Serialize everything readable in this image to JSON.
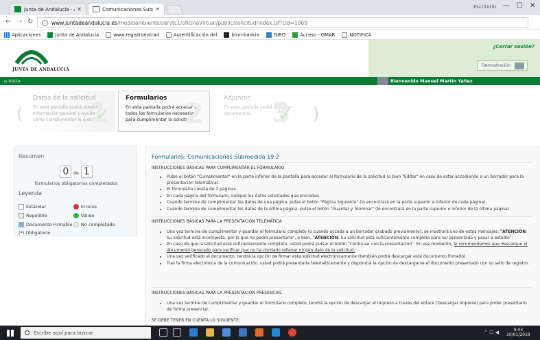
{
  "browser": {
    "tabs": [
      {
        "label": "Junta de Andalucía - Ayu",
        "icon": "junta-favicon"
      },
      {
        "label": "Comunicaciones Submer",
        "icon": "document-favicon"
      }
    ],
    "window_label": "Escritorio",
    "url_domain": "www.juntadeandalucia.es",
    "url_path": "/medioambiente/servtc1/oficinaVirtual/public/solicitud/index.jsf?cid=1969",
    "bookmarks": [
      {
        "label": "Aplicaciones",
        "icon": "apps-icon"
      },
      {
        "label": "Junta de Andalucía",
        "icon": "junta-icon"
      },
      {
        "label": "www.registroentrad",
        "icon": "page-icon"
      },
      {
        "label": "Autentificación del",
        "icon": "mail-icon"
      },
      {
        "label": "bmn-bankia",
        "icon": "bmn-icon"
      },
      {
        "label": "GIRO",
        "icon": "giro-icon"
      },
      {
        "label": "Acceso - GMAR",
        "icon": "gmar-icon"
      },
      {
        "label": "NOTIFICA",
        "icon": "page-icon"
      }
    ]
  },
  "site": {
    "brand": "JUNTA DE ANDALUCIA",
    "logout": "¿Cerrar sesión?",
    "demo_label": "Demostración",
    "home": "Inicio",
    "user_name": "Bienvenido Manuel Martín Yañez",
    "brand_color": "#0a7a33"
  },
  "steps": [
    {
      "number": "1",
      "title": "Datos de la solicitud",
      "desc": "En esta pantalla podrá obtener información general y ayuda de cómo cumplimentar la solicitud."
    },
    {
      "number": "2",
      "title": "Formularios",
      "desc": "En esta pantalla podrá acceder a todos los formularios necesarios para cumplimentar la solicitud."
    },
    {
      "number": "3",
      "title": "Adjuntos",
      "desc": "En esta pantalla podrá adjuntar documentos."
    }
  ],
  "summary": {
    "title": "Resumen",
    "completed": "0",
    "of": "de",
    "total": "1",
    "note": "formularios obligatorios completados",
    "legend_title": "Leyenda",
    "legend": [
      {
        "label": "Estándar",
        "icon": "standard-icon"
      },
      {
        "label": "Errores",
        "icon": "error-icon"
      },
      {
        "label": "Repetible",
        "icon": "repeatable-icon"
      },
      {
        "label": "Válido",
        "icon": "valid-icon"
      },
      {
        "label": "Documento Firmable",
        "icon": "signable-icon"
      },
      {
        "label": "No completado",
        "icon": "not-completed-icon"
      },
      {
        "label": "(*) Obligatorio",
        "icon": ""
      }
    ]
  },
  "main": {
    "title": "Formularios: Comunicaciones Submedida 19.2",
    "section1": "INSTRUCCIONES BÁSICAS PARA CUMPLIMENTAR EL FORMULARIO",
    "section1_items": [
      "Pulse el botón \"Cumplimentar\" en la parte inferior de la pantalla para acceder al formulario de la solicitud (o bien \"Editar\" en caso de estar accediendo a un borrador para la presentación telemática).",
      "El formulario consta de 3 páginas.",
      "En cada página del formulario, indique los datos solicitados que procedan.",
      "Cuando termine de cumplimentar los datos de una página, pulse el botón \"Página Siguiente\" (lo encontrará en la parte superior e inferior de cada página).",
      "Cuando termine de cumplimentar los datos de la última página, pulse el botón \"Guardar y Terminar\" (lo encontrará en la parte superior e inferior de la última página)."
    ],
    "section2": "INSTRUCCIONES BÁSICAS PARA LA PRESENTACIÓN TELEMÁTICA",
    "s2_item1_a": "Una vez termine de cumplimentar y guardar el formulario completo (o cuando acceda a un borrador grabado previamente), se mostrará uno de estos mensajes: ",
    "s2_item1_b1": "\"ATENCIÓN",
    "s2_item1_c": ": Su solicitud está incompleta, por lo que no podrá presentarla\", o bien, \"",
    "s2_item1_b2": "ATENCIÓN",
    "s2_item1_d": ": Su solicitud está suficientemente completa para ser presentada y pasar a estudio\".",
    "s2_item2_a": "En caso de que la solicitud esté suficientemente completa, usted podrá pulsar el botón \"Continuar con la presentación\". En ese momento, ",
    "s2_item2_u": "le recomendamos que descargue el documento generado para verificar que no ha olvidado rellenar ningún dato de la solicitud.",
    "s2_item3": "Una vez verificado el documento, tendrá la opción de firmar esta solicitud electrónicamente (también podrá descargar este documento firmado).",
    "s2_item4": "Tras la firma electrónica de la comunicación, usted podrá presentarla telemáticamente y dispondrá la opción de descargarse el documento presentado con su sello de registro.",
    "section3": "INSTRUCCIONES BÁSICAS PARA LA PRESENTACIÓN PRESENCIAL",
    "s3_item1": "Una vez termine de cumplimentar y guardar el formulario completo, tendrá la opción de descargar el impreso a través del enlace [Descargar Impreso] para poder presentarlo de forma presencial.",
    "section4": "SE DEBE TENER EN CUENTA LO SIGUIENTE:"
  },
  "taskbar": {
    "search_placeholder": "Escribe aquí para buscar",
    "time": "9:03",
    "date": "10/01/2019"
  }
}
